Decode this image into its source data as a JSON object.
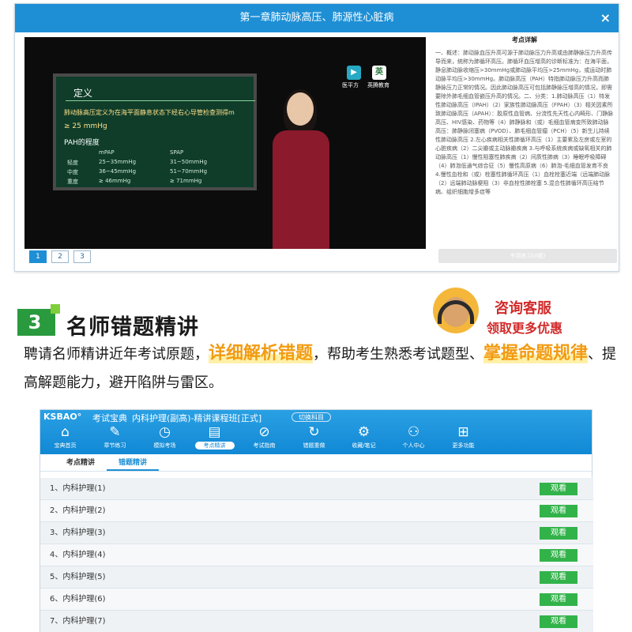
{
  "window": {
    "title": "第一章肺动脉高压、肺源性心脏病",
    "close_glyph": "×",
    "pages": [
      "1",
      "2",
      "3"
    ],
    "active_page": 0
  },
  "video": {
    "board_title": "定义",
    "board_definition": "肺动脉高压定义为在海平面静息状态下经右心导管检查测得m",
    "board_value": "≥ 25 mmHg",
    "board_subtitle": "PAH的程度",
    "table": {
      "headers": [
        "",
        "mPAP",
        "SPAP"
      ],
      "rows": [
        [
          "轻度",
          "25~35mmHg",
          "31~50mmHg"
        ],
        [
          "中度",
          "36~45mmHg",
          "51~70mmHg"
        ],
        [
          "重度",
          "≥ 46mmHg",
          "≥ 71mmHg"
        ]
      ]
    },
    "logo_left_caption": "医平方",
    "logo_right_caption": "英腾教育",
    "logo_right_glyph": "英"
  },
  "notes": {
    "title": "考点详解",
    "body": "一、概述：肺动脉血压升高可源于肺动脉压力升高或由肺静脉压力升高传导而来，统称为肺循环高压。肺循环血压增高的诊断标准为：在海平面，静息肺动脉收缩压>30mmHg或肺动脉平均压>25mmHg，或运动时肺动脉平均压>30mmHg。肺动脉高压（PAH）特指肺动脉压力升高而肺静脉压力正常的情况。因此肺动脉高压可包括肺静脉压增高的情况，即需要除外肺毛细血管嵌压升高的情况。二、分类：1.肺动脉高压（1）特发性肺动脉高压（IPAH）（2）家族性肺动脉高压（FPAH）（3）相关因素所致肺动脉高压（APAH）：胶原性血管病、分流性先天性心内畸形、门静脉高压、HIV感染、药物等（4）肺静脉和（或）毛细血管病变所致肺动脉高压：肺静脉闭塞病（PVOD）、肺毛细血管瘤（PCH）（5）新生儿持续性肺动脉高压 2.左心疾病相关性肺循环高压（1）主要累及左房或左室的心脏疾病（2）二尖瓣或主动脉瓣疾病 3.与呼吸系统疾病或缺氧相关的肺动脉高压（1）慢性阻塞性肺疾病（2）间质性肺病（3）睡眠呼吸障碍（4）肺泡低通气综合征（5）慢性高原病（6）肺泡-毛细血管发育不良 4.慢性血栓和（或）栓塞性肺循环高压（1）血栓栓塞近端（远端肺动脉（2）远端肺动脉梗阻（3）非血栓性肺栓塞 5.混合性肺循环高压结节病、组织细胞增多症等",
    "button": "专项练习(0题)"
  },
  "section": {
    "number": "3",
    "title": "名师错题精讲",
    "cs_line1": "咨询客服",
    "cs_line2": "领取更多优惠"
  },
  "paragraph": {
    "p1": "聘请名师精讲近年考试原题，",
    "h1": "详细解析错题",
    "p2": "，帮助考生熟悉考试题型、",
    "h2": "掌握命题规律",
    "p3": "、提高解题能力，避开陷阱与雷区。"
  },
  "app": {
    "logo": "KSBAO°",
    "name": "考试宝典",
    "course": "内科护理(副高)-精讲课程班[正式]",
    "switch": "切换科目",
    "nav": [
      {
        "label": "宝典首页",
        "icon": "home-icon",
        "glyph": "⌂"
      },
      {
        "label": "章节练习",
        "icon": "edit-icon",
        "glyph": "✎"
      },
      {
        "label": "模拟考场",
        "icon": "clock-icon",
        "glyph": "◷"
      },
      {
        "label": "考点精讲",
        "icon": "document-icon",
        "glyph": "▤"
      },
      {
        "label": "考试指南",
        "icon": "compass-icon",
        "glyph": "⊘"
      },
      {
        "label": "错题重做",
        "icon": "redo-icon",
        "glyph": "↻"
      },
      {
        "label": "收藏/笔记",
        "icon": "settings-icon",
        "glyph": "⚙"
      },
      {
        "label": "个人中心",
        "icon": "user-icon",
        "glyph": "⚇"
      },
      {
        "label": "更多功能",
        "icon": "grid-icon",
        "glyph": "⊞"
      }
    ],
    "active_nav": 3,
    "tabs": [
      "考点精讲",
      "错题精讲"
    ],
    "active_tab": 1,
    "rows": [
      {
        "label": "1、内科护理(1)",
        "button": "观看"
      },
      {
        "label": "2、内科护理(2)",
        "button": "观看"
      },
      {
        "label": "3、内科护理(3)",
        "button": "观看"
      },
      {
        "label": "4、内科护理(4)",
        "button": "观看"
      },
      {
        "label": "5、内科护理(5)",
        "button": "观看"
      },
      {
        "label": "6、内科护理(6)",
        "button": "观看"
      },
      {
        "label": "7、内科护理(7)",
        "button": "观看"
      }
    ],
    "accent": "#1e8fd5",
    "button_color": "#32b34a"
  }
}
